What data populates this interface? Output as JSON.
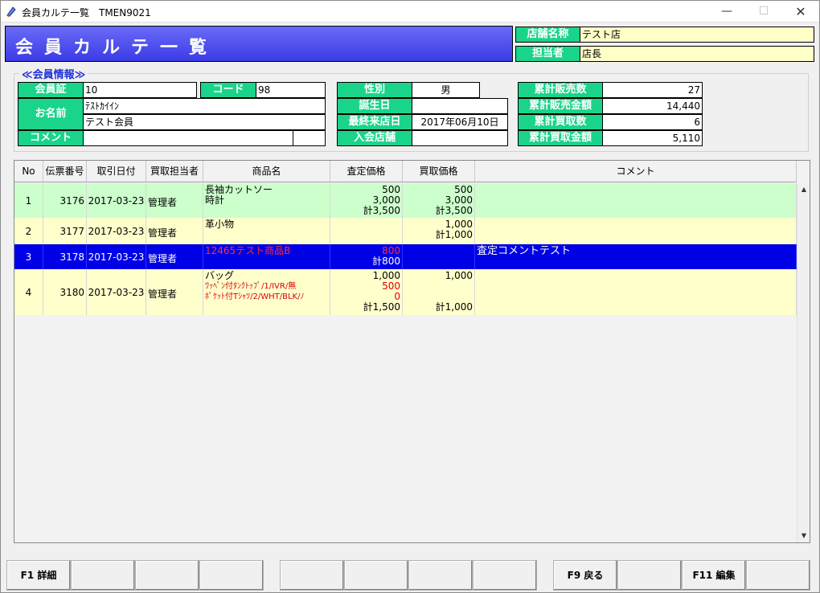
{
  "window": {
    "title": "会員カルテ一覧　TMEN9021",
    "minimize": "—",
    "maximize": "☐",
    "close": "✕"
  },
  "header": {
    "title": "会員カルテ一覧"
  },
  "store": {
    "store_label": "店舗名称",
    "store_value": "テスト店",
    "staff_label": "担当者",
    "staff_value": "店長"
  },
  "member_info": {
    "section_title": "≪会員情報≫",
    "card_label": "会員証",
    "card_value": "10",
    "code_label": "コード",
    "code_value": "98",
    "name_label": "お名前",
    "name_kana": "ﾃｽﾄｶｲｲﾝ",
    "name_value": "テスト会員",
    "comment_label": "コメント",
    "comment_value": "",
    "gender_label": "性別",
    "gender_value": "男",
    "birthday_label": "誕生日",
    "birthday_value": "",
    "last_visit_label": "最終来店日",
    "last_visit_value": "2017年06月10日",
    "join_store_label": "入会店舗",
    "join_store_value": "",
    "total_sales_count_label": "累計販売数",
    "total_sales_count": "27",
    "total_sales_amount_label": "累計販売金額",
    "total_sales_amount": "14,440",
    "total_buy_count_label": "累計買取数",
    "total_buy_count": "6",
    "total_buy_amount_label": "累計買取金額",
    "total_buy_amount": "5,110"
  },
  "grid": {
    "columns": [
      "No",
      "伝票番号",
      "取引日付",
      "買取担当者",
      "商品名",
      "査定価格",
      "買取価格",
      "コメント"
    ],
    "rows": [
      {
        "no": "1",
        "slip": "3176",
        "date": "2017-03-23",
        "staff": "管理者",
        "items": [
          "長袖カットソー",
          "時計"
        ],
        "assess": [
          "500",
          "3,000",
          "計3,500"
        ],
        "buy": [
          "500",
          "3,000",
          "計3,500"
        ],
        "comment": ""
      },
      {
        "no": "2",
        "slip": "3177",
        "date": "2017-03-23",
        "staff": "管理者",
        "items": [
          "革小物"
        ],
        "assess": [],
        "buy": [
          "1,000",
          "計1,000"
        ],
        "comment": ""
      },
      {
        "no": "3",
        "slip": "3178",
        "date": "2017-03-23",
        "staff": "管理者",
        "items": [
          "12465テスト商品B"
        ],
        "assess": [
          "800",
          "計800"
        ],
        "buy": [],
        "comment": "査定コメントテスト"
      },
      {
        "no": "4",
        "slip": "3180",
        "date": "2017-03-23",
        "staff": "管理者",
        "items": [
          "バッグ",
          "ﾜｯﾍﾟﾝ付ﾀﾝｸﾄｯﾌﾟ/1/IVR/無",
          "ﾎﾟｹｯﾄ付Tｼｬﾂ/2/WHT/BLK/ﾉ"
        ],
        "assess": [
          "1,000",
          "500",
          "0",
          "計1,500"
        ],
        "buy": [
          "1,000",
          "計1,000"
        ],
        "comment": ""
      }
    ]
  },
  "scrollbar": {
    "up": "▲",
    "down": "▼"
  },
  "function_keys": {
    "f1": "F1 詳細",
    "f9": "F9 戻る",
    "f11": "F11 編集"
  },
  "colors": {
    "header_blue": "#4a4af0",
    "label_green": "#1ad48a",
    "row_green": "#ccffcc",
    "row_yellow": "#ffffcc",
    "row_selected": "#0000e6",
    "item_red": "#e00000"
  }
}
